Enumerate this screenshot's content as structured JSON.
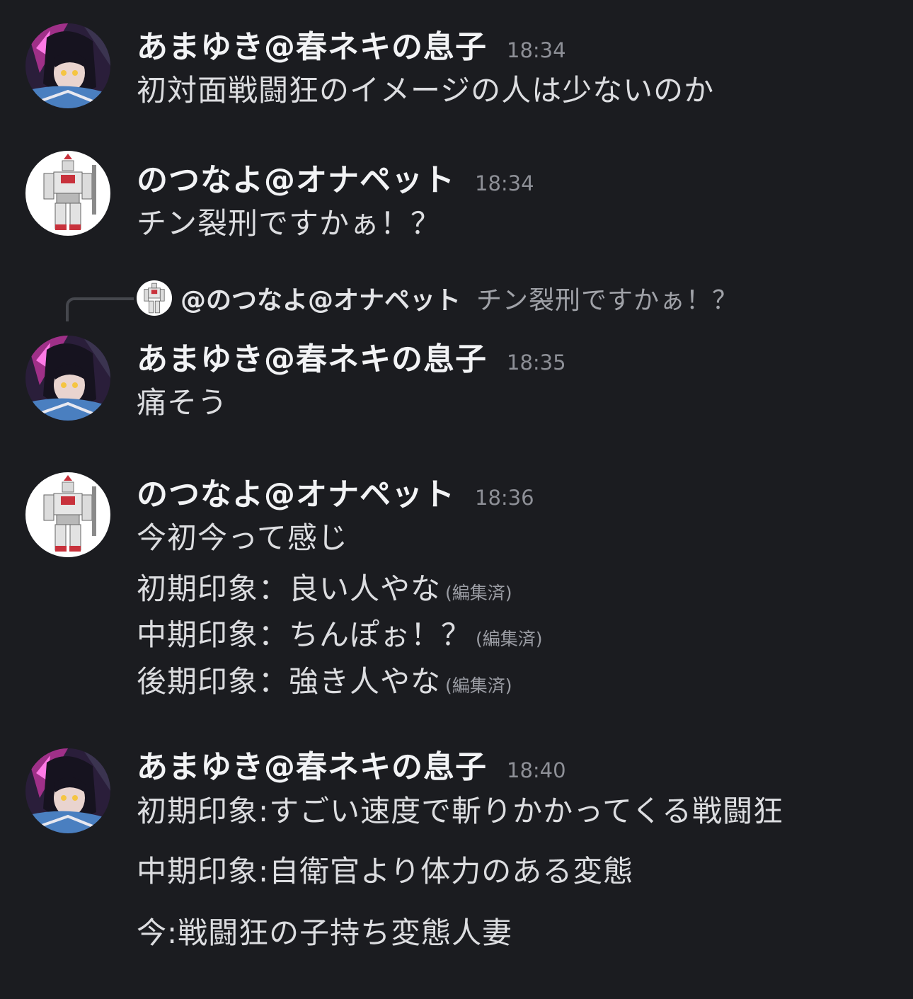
{
  "messages": [
    {
      "avatar": "anime-girl-avatar",
      "username": "あまゆき@春ネキの息子",
      "time": "18:34",
      "lines": [
        "初対面戦闘狂のイメージの人は少ないのか"
      ]
    },
    {
      "avatar": "robot-avatar",
      "username": "のつなよ@オナペット",
      "time": "18:34",
      "lines": [
        "チン裂刑ですかぁ！？"
      ]
    },
    {
      "avatar": "anime-girl-avatar",
      "username": "あまゆき@春ネキの息子",
      "time": "18:35",
      "reply": {
        "avatar": "robot-avatar",
        "mention": "@のつなよ@オナペット",
        "text": "チン裂刑ですかぁ！？"
      },
      "lines": [
        "痛そう"
      ]
    },
    {
      "avatar": "robot-avatar",
      "username": "のつなよ@オナペット",
      "time": "18:36",
      "lines": [
        "今初今って感じ",
        "初期印象：良い人やな",
        "中期印象：ちんぽぉ！？",
        "後期印象：強き人やな"
      ],
      "edited_label": "(編集済)"
    },
    {
      "avatar": "anime-girl-avatar",
      "username": "あまゆき@春ネキの息子",
      "time": "18:40",
      "lines": [
        "初期印象:すごい速度で斬りかかってくる戦闘狂",
        "中期印象:自衛官より体力のある変態",
        "今:戦闘狂の子持ち変態人妻"
      ]
    }
  ]
}
